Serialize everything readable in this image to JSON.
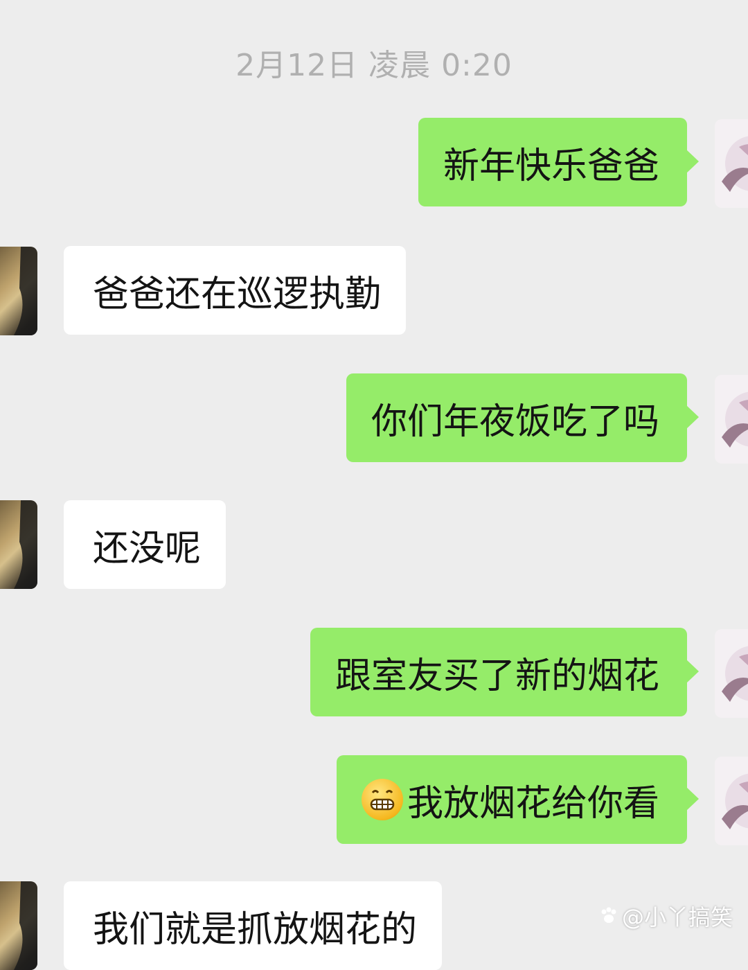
{
  "header": {
    "timestamp": "2月12日  凌晨 0:20"
  },
  "messages": [
    {
      "direction": "out",
      "text": "新年快乐爸爸"
    },
    {
      "direction": "in",
      "text": "爸爸还在巡逻执勤"
    },
    {
      "direction": "out",
      "text": "你们年夜饭吃了吗"
    },
    {
      "direction": "in",
      "text": "还没呢"
    },
    {
      "direction": "out",
      "text": "跟室友买了新的烟花"
    },
    {
      "direction": "out",
      "emoji": "grinning-face",
      "text": "我放烟花给你看"
    },
    {
      "direction": "in",
      "text": "我们就是抓放烟花的"
    }
  ],
  "watermark": {
    "text": "@小丫搞笑"
  },
  "colors": {
    "background": "#ededed",
    "outgoing_bubble": "#95ec69",
    "incoming_bubble": "#ffffff",
    "timestamp": "#b0b0b0"
  }
}
